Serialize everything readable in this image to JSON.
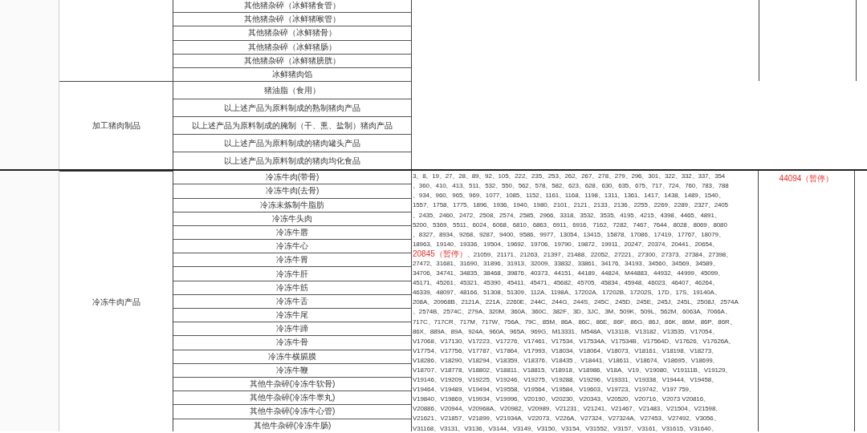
{
  "sections": [
    {
      "products": [
        "其他猪杂碎（冰鲜猪食管）",
        "其他猪杂碎（冰鲜猪喉管）",
        "其他猪杂碎（冰鲜猪骨）",
        "其他猪杂碎（冰鲜猪肠）",
        "其他猪杂碎（冰鲜猪膀胱）",
        "冰鲜猪肉馅"
      ]
    },
    {
      "category": "加工猪肉制品",
      "products": [
        "猪油脂（食用）",
        "以上述产品为原料制成的熟制猪肉产品",
        "以上述产品为原料制成的腌制（干、熏、盐制）猪肉产品",
        "以上述产品为原料制成的猪肉罐头产品",
        "以上述产品为原料制成的猪肉均化食品"
      ]
    },
    {
      "category": "冷冻牛肉产品",
      "products": [
        "冷冻牛肉(带骨)",
        "冷冻牛肉(去骨)",
        "冷冻未炼制牛脂肪",
        "冷冻牛头肉",
        "冷冻牛唇",
        "冷冻牛心",
        "冷冻牛胃",
        "冷冻牛肝",
        "冷冻牛筋",
        "冷冻牛舌",
        "冷冻牛尾",
        "冷冻牛蹄",
        "冷冻牛骨",
        "冷冻牛横膈膜",
        "冷冻牛鞭",
        "其他牛杂碎(冷冻牛软骨)",
        "其他牛杂碎(冷冻牛睾丸)",
        "其他牛杂碎(冷冻牛心管)",
        "其他牛杂碎(冷冻牛肠)"
      ],
      "codes": [
        [
          {
            "text": "3、8、19、27、28、89、92、105、222、235、253、262、267、278、279、296、301、322、332、337、354",
            "suspended": false
          }
        ],
        [
          {
            "text": "、360、410、413、511、532、550、562、578、582、623、628、630、635、675、717、724、760、783、788",
            "suspended": false
          }
        ],
        [
          {
            "text": "、934、960、965、969、1077、1085、1152、1161、1168、1198、1311、1361、1417、1438、1489、1540、",
            "suspended": false
          }
        ],
        [
          {
            "text": "1557、1758、1775、1896、1936、1940、1980、2101、2121、2133、2136、2255、2269、2289、2327、2405",
            "suspended": false
          }
        ],
        [
          {
            "text": "、2435、2460、2472、2508、2574、2585、2966、3318、3532、3535、4195、4215、4398、4465、4891、",
            "suspended": false
          }
        ],
        [
          {
            "text": "5200、5369、5511、6024、6068、6810、6863、6911、6916、7162、7282、7467、7644、8028、8069、8080",
            "suspended": false
          }
        ],
        [
          {
            "text": "、8327、8934、9268、9287、9400、9586、9977、13054、13415、15878、17086、17419、17767、18079、",
            "suspended": false
          }
        ],
        [
          {
            "text": "18963、19140、19336、19504、19692、19706、19790、19872、19911、20247、20374、20441、20654、",
            "suspended": false
          }
        ],
        [
          {
            "text": "20845（暂停）",
            "suspended": true
          },
          {
            "text": "、21059、21171、21263、21397、21488、22052、27221、27300、27373、27384、27398、",
            "suspended": false
          }
        ],
        [
          {
            "text": "27472、31681、31690、31896、31913、32009、33832、33861、34176、34193、34560、34569、34589、",
            "suspended": false
          }
        ],
        [
          {
            "text": "34706、34741、34835、38468、39876、40373、44151、44189、44824、M44883、44932、44999、45099、",
            "suspended": false
          }
        ],
        [
          {
            "text": "45171、45261、45321、45390、45411、45471、45682、45705、45834、45948、46023、46407、46264、",
            "suspended": false
          }
        ],
        [
          {
            "text": "46339、48097、48166、51308、51309、112A、1198A、17202A、17202B、17202S、17D、17S、19140A、",
            "suspended": false
          }
        ],
        [
          {
            "text": "208A、20968B、2121A、221A、2260E、244C、244G、244S、245C、245D、245E、245J、245L、2508J、2574A",
            "suspended": false
          }
        ],
        [
          {
            "text": "、2574B、2574C、279A、320M、360A、360C、382F、3D、3JC、3M、509K、509L、562M、6063A、7066A、",
            "suspended": false
          }
        ],
        [
          {
            "text": "717C、717CR、717M、717W、756A、79C、85M、86A、86C、86E、86F、86G、86J、86K、86M、86P、86R、",
            "suspended": false
          }
        ],
        [
          {
            "text": "86X、889A、89A、924A、960A、965A、969G、M13331、M548A、V1311B、V13182、V13535、V17054、",
            "suspended": false
          }
        ],
        [
          {
            "text": "V17068、V17130、V17223、V17276、V17461、V17534、V17534A、V17534B、V17564D、V17626、V17626A、",
            "suspended": false
          }
        ],
        [
          {
            "text": "V17754、V17756、V17787、V17864、V17993、V18034、V18064、V18073、V18161、V18198、V18273、",
            "suspended": false
          }
        ],
        [
          {
            "text": "V18286、V18290、V18294、V18359、V18376、V18435 、V18441、V18611、V18674、V18695、V18699、",
            "suspended": false
          }
        ],
        [
          {
            "text": "V18707、V18778、V18802、V18811、V18815、V18918、V18986、V18A、V19、V19080、V19111B、V19129、",
            "suspended": false
          }
        ],
        [
          {
            "text": "V19146、V19209、V19225、V19246、V19275、V19288、V19296、V19331、V19338、V19444、V19458、",
            "suspended": false
          }
        ],
        [
          {
            "text": "V19464、V19489、V19494、V19558、V19564、V19584、V19603、V19723、V19742、V197 759、",
            "suspended": false
          }
        ],
        [
          {
            "text": "V19840、V19869、V19934、V19996、V20190、V20230、V20343、V20520、V20716、V2073 V20816、",
            "suspended": false
          }
        ],
        [
          {
            "text": "V20886、V20944、V20968A、V20982、V20989、V21231、V21241、V21467、V21483、V21504、V21598、",
            "suspended": false
          }
        ],
        [
          {
            "text": "V21621、V21857、V21899、V21934A、V22073、V226A、V27324、V27324A、V27453、V27492、V3056、",
            "suspended": false
          }
        ],
        [
          {
            "text": "V31168、V3131、V3136、V3144、V3149、V3150、V3154、V31552、V3157、V3161、V31615、V31640、",
            "suspended": false
          }
        ]
      ],
      "note": {
        "text": "44094（暂停）",
        "suspended": true
      }
    }
  ]
}
